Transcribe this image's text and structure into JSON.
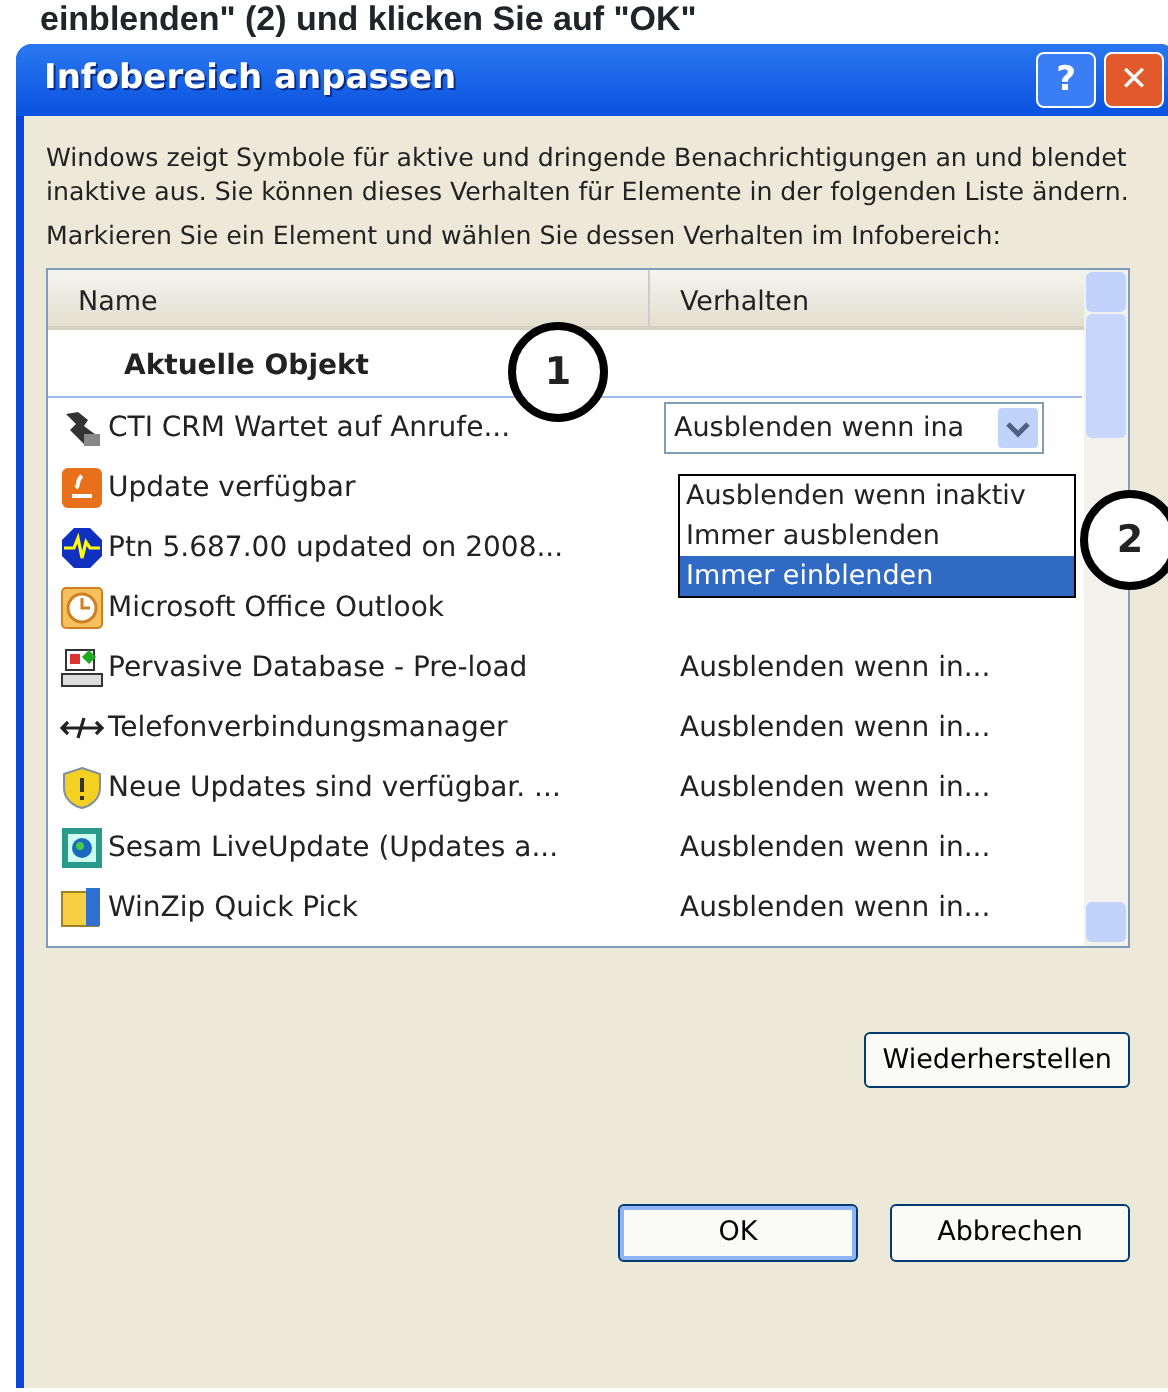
{
  "caption": "einblenden\" (2) und klicken Sie auf \"OK\"",
  "window": {
    "title": "Infobereich anpassen",
    "buttons": [
      "?",
      "✕"
    ]
  },
  "intro": "Windows zeigt Symbole für aktive und dringende Benachrichtigungen an und blendet inaktive aus. Sie können dieses Verhalten für Elemente in der folgenden Liste ändern.",
  "instruction": "Markieren Sie ein Element und wählen Sie dessen Verhalten im Infobereich:",
  "table": {
    "columns": [
      "Name",
      "Verhalten"
    ],
    "group": "Aktuelle Objekt",
    "rows": [
      {
        "name": "CTI CRM Wartet auf Anrufe...",
        "kind": "dropdown",
        "behavior": "Ausblenden wenn ina",
        "options": [
          {
            "label": "Ausblenden wenn inaktiv",
            "selected": false
          },
          {
            "label": "Immer ausblenden",
            "selected": false
          },
          {
            "label": "Immer einblenden",
            "selected": true
          }
        ]
      },
      {
        "name": "Update verfügbar",
        "kind": "text"
      },
      {
        "name": "Ptn 5.687.00 updated on 2008...",
        "kind": "text"
      },
      {
        "name": "Microsoft Office Outlook",
        "kind": "text"
      },
      {
        "name": "Pervasive Database - Pre-load",
        "kind": "text",
        "behavior": "Ausblenden wenn in..."
      },
      {
        "name": "Telefonverbindungsmanager",
        "kind": "text",
        "behavior": "Ausblenden wenn in..."
      },
      {
        "name": "Neue Updates sind verfügbar. ...",
        "kind": "text",
        "behavior": "Ausblenden wenn in..."
      },
      {
        "name": "Sesam LiveUpdate (Updates a...",
        "kind": "text",
        "behavior": "Ausblenden wenn in..."
      },
      {
        "name": "WinZip Quick Pick",
        "kind": "text",
        "behavior": "Ausblenden wenn in..."
      }
    ]
  },
  "callouts": [
    "1",
    "2"
  ],
  "buttons": {
    "restore": "Wiederherstellen",
    "ok": "OK",
    "cancel": "Abbrechen"
  }
}
